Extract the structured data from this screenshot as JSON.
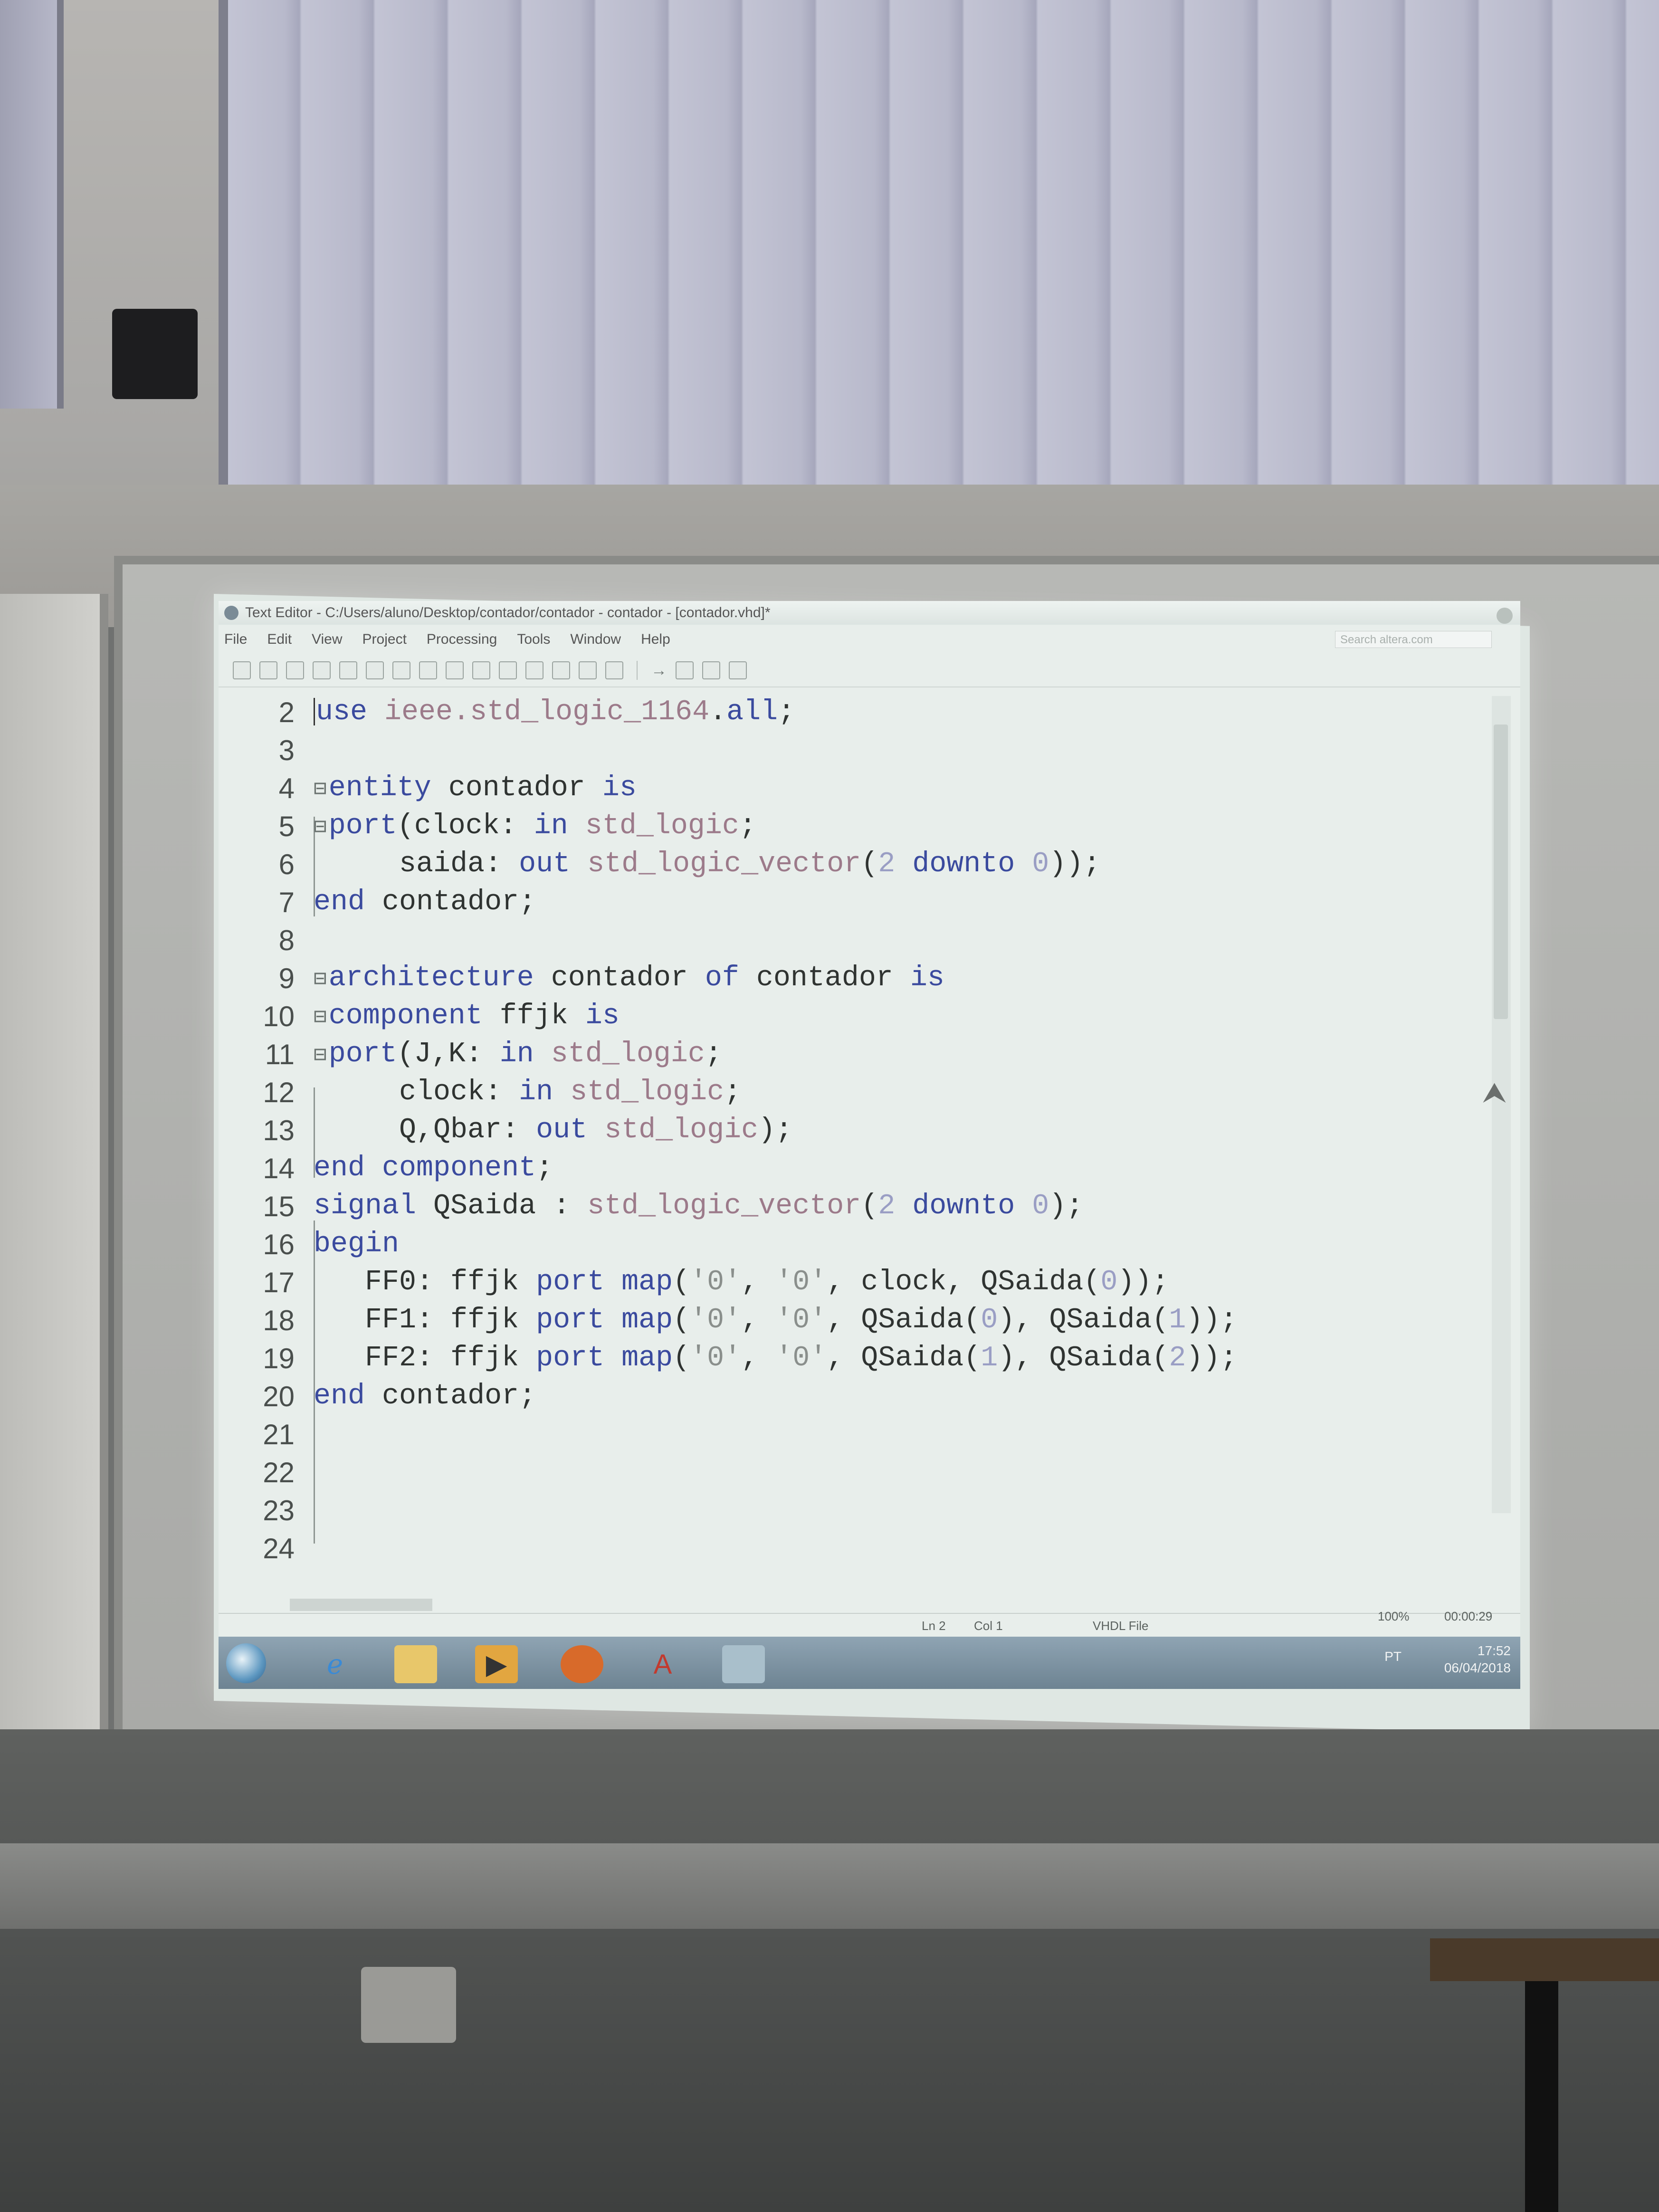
{
  "window": {
    "title": "Text Editor - C:/Users/aluno/Desktop/contador/contador - contador - [contador.vhd]*"
  },
  "menu": [
    "File",
    "Edit",
    "View",
    "Project",
    "Processing",
    "Tools",
    "Window",
    "Help"
  ],
  "search": {
    "placeholder": "Search altera.com"
  },
  "editor": {
    "lines": [
      {
        "n": "2",
        "fold": "",
        "indent": "",
        "tokens": [
          [
            "kw",
            "use"
          ],
          [
            "type",
            " ieee.std_logic_1164"
          ],
          [
            "",
            "."
          ],
          [
            "kw",
            "all"
          ],
          [
            "",
            ";"
          ]
        ]
      },
      {
        "n": "3",
        "fold": "",
        "indent": "",
        "tokens": []
      },
      {
        "n": "4",
        "fold": "⊟",
        "indent": "",
        "tokens": [
          [
            "kw",
            "entity"
          ],
          [
            "",
            " contador "
          ],
          [
            "kw",
            "is"
          ]
        ]
      },
      {
        "n": "5",
        "fold": "⊟",
        "indent": "",
        "tokens": [
          [
            "kw",
            "port"
          ],
          [
            "",
            "(clock: "
          ],
          [
            "kw",
            "in"
          ],
          [
            "type",
            " std_logic"
          ],
          [
            "",
            ";"
          ]
        ]
      },
      {
        "n": "6",
        "fold": "",
        "indent": "     ",
        "tokens": [
          [
            "",
            "saida: "
          ],
          [
            "kw",
            "out"
          ],
          [
            "type",
            " std_logic_vector"
          ],
          [
            "",
            "("
          ],
          [
            "num",
            "2"
          ],
          [
            "kw",
            " downto"
          ],
          [
            "num",
            " 0"
          ],
          [
            "",
            "));"
          ]
        ]
      },
      {
        "n": "7",
        "fold": "",
        "indent": "",
        "tokens": [
          [
            "kw",
            "end"
          ],
          [
            "",
            " contador;"
          ]
        ]
      },
      {
        "n": "8",
        "fold": "",
        "indent": "",
        "tokens": []
      },
      {
        "n": "9",
        "fold": "⊟",
        "indent": "",
        "tokens": [
          [
            "kw",
            "architecture"
          ],
          [
            "",
            " contador "
          ],
          [
            "kw",
            "of"
          ],
          [
            "",
            " contador "
          ],
          [
            "kw",
            "is"
          ]
        ]
      },
      {
        "n": "10",
        "fold": "⊟",
        "indent": "",
        "tokens": [
          [
            "kw",
            "component"
          ],
          [
            "",
            " ffjk "
          ],
          [
            "kw",
            "is"
          ]
        ]
      },
      {
        "n": "11",
        "fold": "⊟",
        "indent": "",
        "tokens": [
          [
            "kw",
            "port"
          ],
          [
            "",
            "(J,K: "
          ],
          [
            "kw",
            "in"
          ],
          [
            "type",
            " std_logic"
          ],
          [
            "",
            ";"
          ]
        ]
      },
      {
        "n": "12",
        "fold": "",
        "indent": "     ",
        "tokens": [
          [
            "",
            "clock: "
          ],
          [
            "kw",
            "in"
          ],
          [
            "type",
            " std_logic"
          ],
          [
            "",
            ";"
          ]
        ]
      },
      {
        "n": "13",
        "fold": "",
        "indent": "     ",
        "tokens": [
          [
            "",
            "Q,Qbar: "
          ],
          [
            "kw",
            "out"
          ],
          [
            "type",
            " std_logic"
          ],
          [
            "",
            ");"
          ]
        ]
      },
      {
        "n": "14",
        "fold": "",
        "indent": "",
        "tokens": [
          [
            "kw",
            "end component"
          ],
          [
            "",
            ";"
          ]
        ]
      },
      {
        "n": "15",
        "fold": "",
        "indent": "",
        "tokens": [
          [
            "kw",
            "signal"
          ],
          [
            "",
            " QSaida : "
          ],
          [
            "type",
            "std_logic_vector"
          ],
          [
            "",
            "("
          ],
          [
            "num",
            "2"
          ],
          [
            "kw",
            " downto"
          ],
          [
            "num",
            " 0"
          ],
          [
            "",
            ");"
          ]
        ]
      },
      {
        "n": "16",
        "fold": "",
        "indent": "",
        "tokens": [
          [
            "kw",
            "begin"
          ]
        ]
      },
      {
        "n": "17",
        "fold": "",
        "indent": "   ",
        "tokens": [
          [
            "",
            "FF0: ffjk "
          ],
          [
            "kw",
            "port map"
          ],
          [
            "",
            "("
          ],
          [
            "str",
            "'0'"
          ],
          [
            "",
            ", "
          ],
          [
            "str",
            "'0'"
          ],
          [
            "",
            ", clock, QSaida("
          ],
          [
            "num",
            "0"
          ],
          [
            "",
            "));"
          ]
        ]
      },
      {
        "n": "18",
        "fold": "",
        "indent": "   ",
        "tokens": [
          [
            "",
            "FF1: ffjk "
          ],
          [
            "kw",
            "port map"
          ],
          [
            "",
            "("
          ],
          [
            "str",
            "'0'"
          ],
          [
            "",
            ", "
          ],
          [
            "str",
            "'0'"
          ],
          [
            "",
            ", QSaida("
          ],
          [
            "num",
            "0"
          ],
          [
            "",
            "), QSaida("
          ],
          [
            "num",
            "1"
          ],
          [
            "",
            "));"
          ]
        ]
      },
      {
        "n": "19",
        "fold": "",
        "indent": "   ",
        "tokens": [
          [
            "",
            "FF2: ffjk "
          ],
          [
            "kw",
            "port map"
          ],
          [
            "",
            "("
          ],
          [
            "str",
            "'0'"
          ],
          [
            "",
            ", "
          ],
          [
            "str",
            "'0'"
          ],
          [
            "",
            ", QSaida("
          ],
          [
            "num",
            "1"
          ],
          [
            "",
            "), QSaida("
          ],
          [
            "num",
            "2"
          ],
          [
            "",
            "));"
          ]
        ]
      },
      {
        "n": "20",
        "fold": "",
        "indent": "",
        "tokens": [
          [
            "kw",
            "end"
          ],
          [
            "",
            " contador;"
          ]
        ]
      },
      {
        "n": "21",
        "fold": "",
        "indent": "",
        "tokens": []
      },
      {
        "n": "22",
        "fold": "",
        "indent": "",
        "tokens": []
      },
      {
        "n": "23",
        "fold": "",
        "indent": "",
        "tokens": []
      },
      {
        "n": "24",
        "fold": "",
        "indent": "",
        "tokens": []
      }
    ]
  },
  "status": {
    "position": "Ln 2",
    "column": "Col 1",
    "filetype": "VHDL File",
    "zoom": "100%",
    "elapsed": "00:00:29"
  },
  "taskbar": {
    "apps": [
      "start-orb",
      "internet-explorer-icon",
      "file-explorer-icon",
      "media-player-icon",
      "firefox-icon",
      "acrobat-icon",
      "quartus-icon"
    ],
    "language": "PT",
    "time": "17:52",
    "date": "06/04/2018"
  },
  "colors": {
    "keyword": "#3a4a9e",
    "type": "#9c7a8a",
    "number": "#9a9ec4",
    "string": "#8a8f8c",
    "projection": "#dfe7e3"
  }
}
